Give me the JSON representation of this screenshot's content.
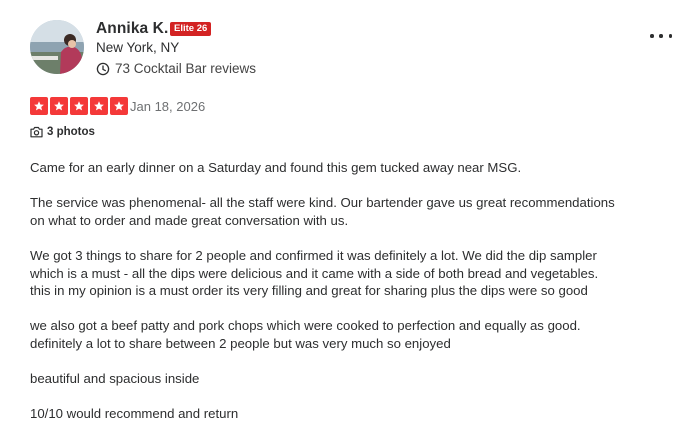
{
  "user": {
    "name": "Annika K.",
    "elite_badge": "Elite 26",
    "location": "New York, NY",
    "reviews_count": "73 Cocktail Bar reviews",
    "avatar_icon": "user-photo"
  },
  "review": {
    "rating": 5,
    "rating_max": 5,
    "date": "Jan 18, 2026",
    "photos_label": "3 photos",
    "paragraphs": [
      [
        "Came for an early dinner on a Saturday and found this gem tucked away near MSG."
      ],
      [
        "The service was phenomenal- all the staff were kind. Our bartender gave us great recommendations",
        "on what to order and made great conversation with us."
      ],
      [
        "We got 3 things to share for 2 people and confirmed it was definitely a lot. We did the dip sampler",
        "which is a must - all the dips were delicious and it came with a side of both bread and vegetables.",
        "this in my opinion is a must order its very filling and great for sharing plus the dips were so good"
      ],
      [
        "we also got a beef patty and pork chops which were cooked to perfection and equally as good.",
        "definitely a lot to share between 2 people but was very much so enjoyed"
      ],
      [
        "beautiful and spacious inside"
      ],
      [
        "10/10 would recommend and return"
      ]
    ]
  },
  "icons": {
    "more": "more-horizontal-icon",
    "reviews": "review-history-icon",
    "camera": "camera-icon",
    "star": "star-icon"
  },
  "colors": {
    "star_fill": "#f43939",
    "elite_badge": "#d32323",
    "text": "#2d2e2f",
    "date": "#6e7072"
  }
}
